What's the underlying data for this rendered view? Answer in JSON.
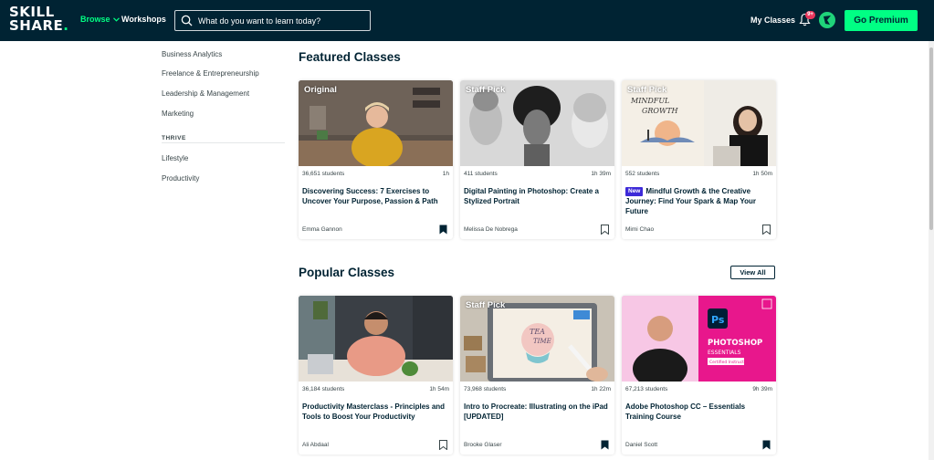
{
  "brand": {
    "logo_line1": "SKILL",
    "logo_line2": "SHARE",
    "logo_dot": ".",
    "accent": "#00ff84",
    "dark": "#002333"
  },
  "nav": {
    "browse_label": "Browse",
    "workshops_label": "Workshops",
    "search_placeholder": "What do you want to learn today?",
    "my_classes_label": "My Classes",
    "notification_count": "9+",
    "premium_label": "Go Premium"
  },
  "sidebar": {
    "items_top": [
      {
        "label": "Business Analytics"
      },
      {
        "label": "Freelance & Entrepreneurship"
      },
      {
        "label": "Leadership & Management"
      },
      {
        "label": "Marketing"
      }
    ],
    "heading": "THRIVE",
    "items_bottom": [
      {
        "label": "Lifestyle"
      },
      {
        "label": "Productivity"
      }
    ]
  },
  "featured": {
    "title": "Featured Classes",
    "cards": [
      {
        "label": "Original",
        "students": "36,651 students",
        "duration": "1h",
        "title": "Discovering Success: 7 Exercises to Uncover Your Purpose, Passion & Path",
        "new": "",
        "author": "Emma Gannon",
        "saved": true
      },
      {
        "label": "Staff Pick",
        "students": "411 students",
        "duration": "1h 39m",
        "title": "Digital Painting in Photoshop: Create a Stylized Portrait",
        "new": "",
        "author": "Melissa De Nobrega",
        "saved": false
      },
      {
        "label": "Staff Pick",
        "students": "552 students",
        "duration": "1h 50m",
        "title": "Mindful Growth & the Creative Journey: Find Your Spark & Map Your Future",
        "new": "New",
        "author": "Mimi Chao",
        "saved": false
      }
    ]
  },
  "popular": {
    "title": "Popular Classes",
    "view_all_label": "View All",
    "cards": [
      {
        "label": "",
        "students": "36,184 students",
        "duration": "1h 54m",
        "title": "Productivity Masterclass - Principles and Tools to Boost Your Productivity",
        "new": "",
        "author": "Ali Abdaal",
        "saved": false
      },
      {
        "label": "Staff Pick",
        "students": "73,968 students",
        "duration": "1h 22m",
        "title": "Intro to Procreate: Illustrating on the iPad [UPDATED]",
        "new": "",
        "author": "Brooke Glaser",
        "saved": true
      },
      {
        "label": "",
        "students": "67,213 students",
        "duration": "9h 39m",
        "title": "Adobe Photoshop CC – Essentials Training Course",
        "new": "",
        "author": "Daniel Scott",
        "saved": true
      }
    ]
  },
  "thumb_text": {
    "mindful_1": "MINDFUL",
    "mindful_2": "GROWTH",
    "tea_1": "TEA",
    "tea_2": "TIME",
    "ps_logo": "Ps",
    "ps_title_1": "PHOTOSHOP",
    "ps_title_2": "ESSENTIALS",
    "ps_badge": "Certified Instructor"
  }
}
